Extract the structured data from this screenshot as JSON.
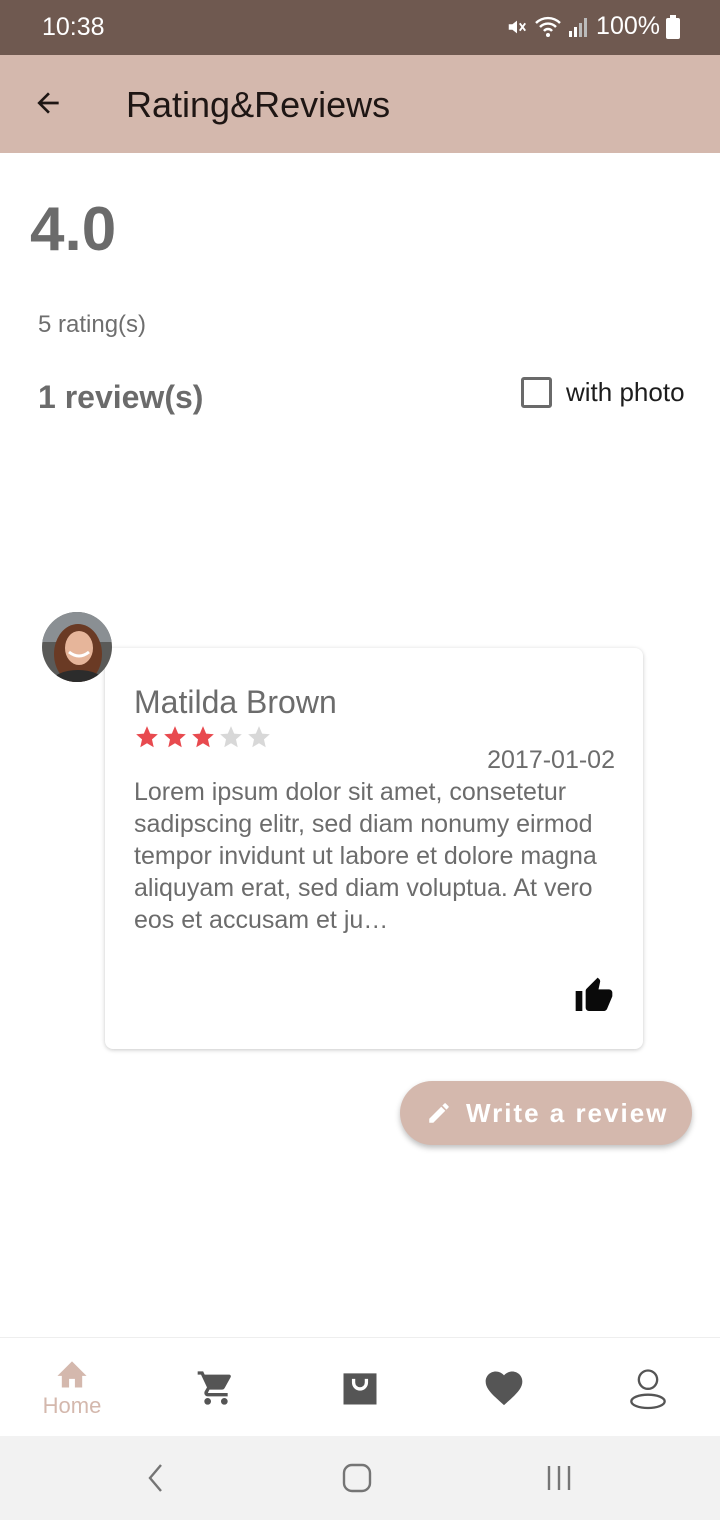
{
  "status_bar": {
    "time": "10:38",
    "battery": "100%"
  },
  "app_bar": {
    "title": "Rating&Reviews"
  },
  "summary": {
    "rating": "4.0",
    "ratings_count": "5 rating(s)",
    "reviews_count": "1 review(s)",
    "with_photo_label": "with photo",
    "with_photo_checked": false
  },
  "review": {
    "name": "Matilda Brown",
    "stars": 3,
    "max_stars": 5,
    "date": "2017-01-02",
    "text": "Lorem ipsum dolor sit amet, consetetur sadipscing elitr, sed diam nonumy eirmod tempor invidunt ut labore et dolore magna aliquyam erat, sed diam voluptua. At vero eos et accusam et ju…"
  },
  "write_review_label": "Write a review",
  "bottom_nav": {
    "home_label": "Home"
  },
  "colors": {
    "status_bar": "#6f5950",
    "accent": "#d4b8ad",
    "star_filled": "#e84a4f",
    "star_empty": "#d8d8d8",
    "text_gray": "#6c6c6c"
  }
}
